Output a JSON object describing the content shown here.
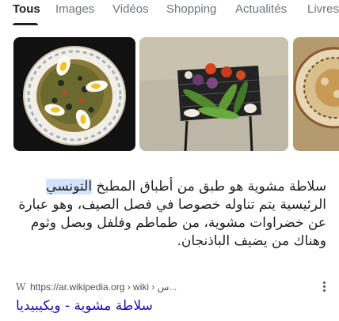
{
  "tabs": [
    {
      "label": "Tous",
      "active": true
    },
    {
      "label": "Images",
      "active": false
    },
    {
      "label": "Vidéos",
      "active": false
    },
    {
      "label": "Shopping",
      "active": false
    },
    {
      "label": "Actualités",
      "active": false
    },
    {
      "label": "Livres",
      "active": false
    }
  ],
  "images": [
    {
      "icon": "grilled-salad-plate-image"
    },
    {
      "icon": "vegetables-on-grill-image"
    },
    {
      "icon": "ceramic-dish-image"
    }
  ],
  "snippet": {
    "part1": "سلاطة مشوية هو طبق من أطباق المطبخ ",
    "highlight": "التونسي",
    "part2": " الرئيسية يتم تناوله خصوصا في فصل الصيف، وهو عبارة عن خضراوات مشوية، من طماطم وفلفل وبصل وثوم وهناك من يضيف الباذنجان."
  },
  "source": {
    "favicon": "W",
    "url": "https://ar.wikipedia.org › wiki › س..."
  },
  "result_title": "سلاطة مشوية - ويكيبيديا",
  "colors": {
    "link": "#1a0dab",
    "highlight": "#d2e3fc",
    "tab_inactive": "#70757a"
  }
}
